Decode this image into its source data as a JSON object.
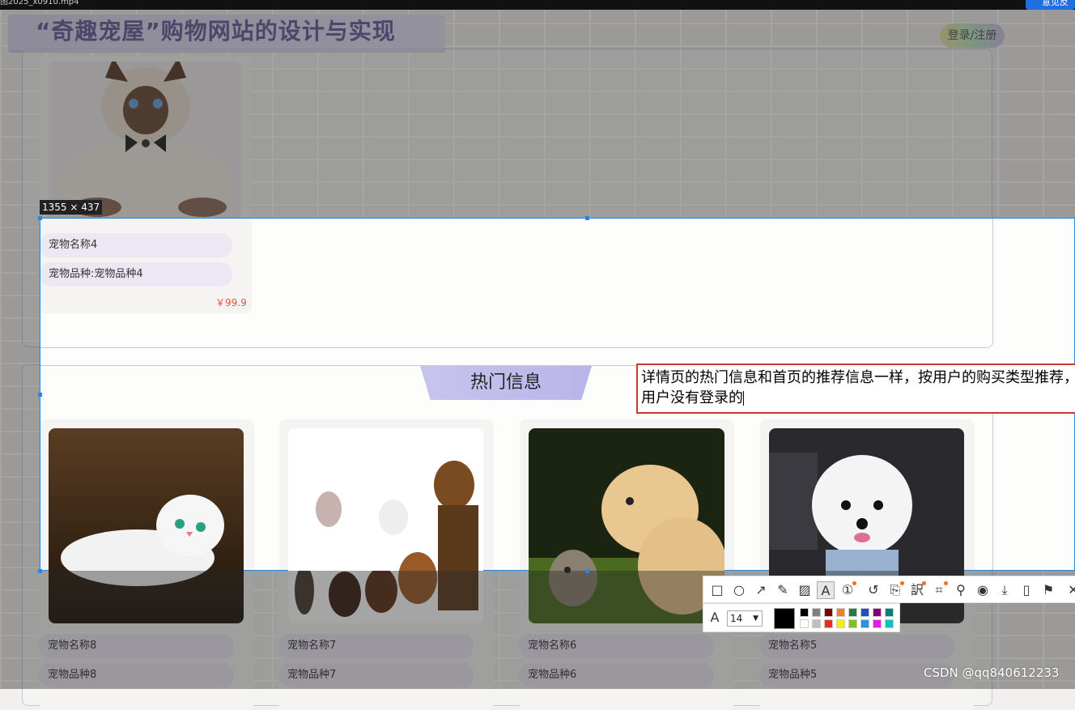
{
  "window": {
    "filename": "图2025_x0910.mp4",
    "top_button": "意见反"
  },
  "header": {
    "title": "“奇趣宠屋”购物网站的设计与实现",
    "login": "登录/注册"
  },
  "section1": {
    "card": {
      "name": "宠物名称4",
      "breed": "宠物品种:宠物品种4",
      "price": "￥99.9"
    }
  },
  "hot": {
    "title": "热门信息",
    "cards": [
      {
        "name": "宠物名称8",
        "breed": "宠物品种8"
      },
      {
        "name": "宠物名称7",
        "breed": "宠物品种7"
      },
      {
        "name": "宠物名称6",
        "breed": "宠物品种6"
      },
      {
        "name": "宠物名称5",
        "breed": "宠物品种5"
      }
    ]
  },
  "capture": {
    "size_label": "1355 × 437",
    "annotation_text": "详情页的热门信息和首页的推荐信息一样，按用户的购买类型推荐，用户没有登录的",
    "font_size": "14",
    "tools": [
      "rect-icon",
      "ellipse-icon",
      "arrow-icon",
      "pen-icon",
      "mosaic-icon",
      "text-icon",
      "number-icon",
      "undo-icon",
      "ocr-icon",
      "translate-icon",
      "scan-icon",
      "pin-icon",
      "record-icon",
      "download-icon",
      "save-icon",
      "bookmark-icon",
      "close-icon"
    ],
    "palette": [
      "#000000",
      "#808080",
      "#800000",
      "#f08030",
      "#208040",
      "#2050c0",
      "#800080",
      "#008080",
      "#ffffff",
      "#c0c0c0",
      "#e03020",
      "#f0f000",
      "#80c020",
      "#3090e0",
      "#e020e0",
      "#10c0c0"
    ]
  },
  "watermark": "CSDN @qq840612233"
}
